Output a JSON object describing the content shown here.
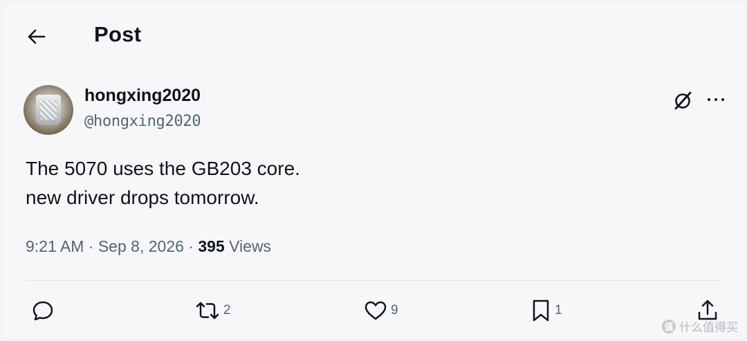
{
  "header": {
    "title": "Post",
    "back_icon": "arrow-left-icon"
  },
  "author": {
    "display_name": "hongxing2020",
    "handle": "@hongxing2020",
    "avatar_icon": "avatar-photo"
  },
  "top_actions": {
    "grok_icon": "grok-icon",
    "more_icon": "more-horizontal-icon"
  },
  "tweet": {
    "lines": [
      "The 5070 uses the GB203 core.",
      "new driver drops tomorrow."
    ]
  },
  "meta": {
    "time": "9:21 AM",
    "separator": " · ",
    "date": "Sep 8, 2026",
    "views_count": "395",
    "views_label": "Views"
  },
  "actions": {
    "reply": {
      "icon": "reply-icon",
      "count": ""
    },
    "retweet": {
      "icon": "retweet-icon",
      "count": "2"
    },
    "like": {
      "icon": "heart-icon",
      "count": "9"
    },
    "bookmark": {
      "icon": "bookmark-icon",
      "count": "1"
    },
    "share": {
      "icon": "share-icon",
      "count": ""
    }
  },
  "watermark": {
    "badge": "值",
    "text": "什么值得买"
  },
  "colors": {
    "text_primary": "#0f1419",
    "text_secondary": "#536471",
    "background": "#f7f7fa"
  }
}
